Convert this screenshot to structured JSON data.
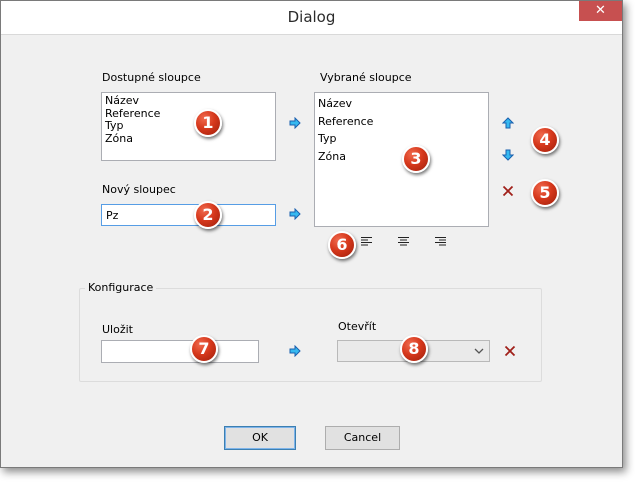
{
  "window": {
    "title": "Dialog",
    "close_glyph": "✕"
  },
  "available": {
    "label": "Dostupné sloupce",
    "items": [
      "Název",
      "Reference",
      "Typ",
      "Zóna"
    ]
  },
  "selected": {
    "label": "Vybrané sloupce",
    "items": [
      "Název",
      "Reference",
      "Typ",
      "Zóna"
    ]
  },
  "new_column": {
    "label": "Nový sloupec",
    "value": "Pz"
  },
  "configuration": {
    "title": "Konfigurace",
    "save_label": "Uložit",
    "save_value": "",
    "open_label": "Otevřít",
    "open_value": ""
  },
  "buttons": {
    "ok": "OK",
    "cancel": "Cancel"
  },
  "markers": [
    "1",
    "2",
    "3",
    "4",
    "5",
    "6",
    "7",
    "8"
  ],
  "icons": {
    "move_right": "arrow-right-icon",
    "move_up": "arrow-up-icon",
    "move_down": "arrow-down-icon",
    "delete": "delete-x-icon",
    "align_left": "align-left-icon",
    "align_center": "align-center-icon",
    "align_right": "align-right-icon",
    "dropdown": "chevron-down-icon"
  },
  "colors": {
    "arrow_fill": "#35b9f0",
    "arrow_stroke": "#1a5fae",
    "delete": "#a0201a",
    "marker": "#d6381c",
    "close_button": "#c75050"
  }
}
